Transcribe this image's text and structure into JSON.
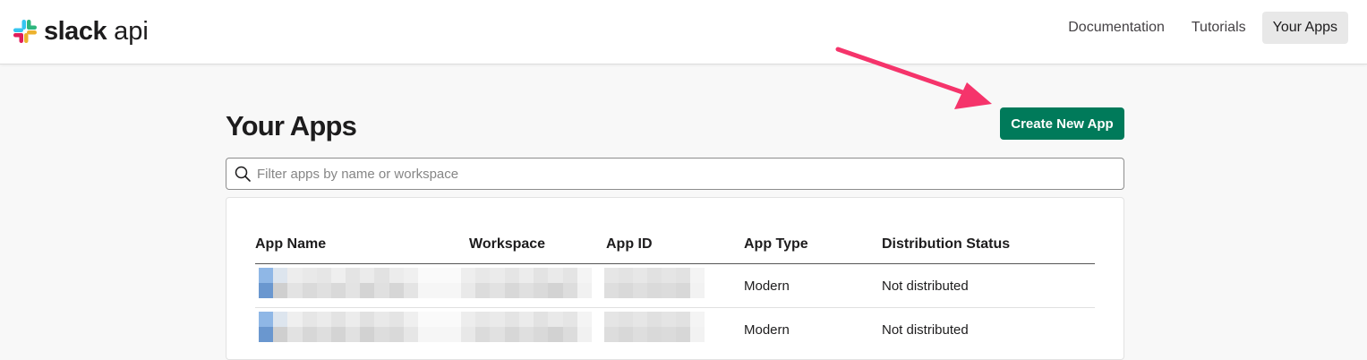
{
  "header": {
    "logo": {
      "word": "slack",
      "sub": "api"
    },
    "nav": [
      {
        "label": "Documentation",
        "active": false
      },
      {
        "label": "Tutorials",
        "active": false
      },
      {
        "label": "Your Apps",
        "active": true
      }
    ]
  },
  "main": {
    "title": "Your Apps",
    "create_button": "Create New App",
    "search": {
      "placeholder": "Filter apps by name or workspace",
      "value": ""
    },
    "table": {
      "columns": [
        "App Name",
        "Workspace",
        "App ID",
        "App Type",
        "Distribution Status"
      ],
      "rows": [
        {
          "app_name": "[pixelated]",
          "workspace": "[pixelated]",
          "app_id": "[pixelated]",
          "app_type": "Modern",
          "distribution_status": "Not distributed"
        },
        {
          "app_name": "[pixelated]",
          "workspace": "[pixelated]",
          "app_id": "[pixelated]",
          "app_type": "Modern",
          "distribution_status": "Not distributed"
        }
      ]
    }
  },
  "colors": {
    "primary_button": "#007a5a",
    "annotation_arrow": "#f5346b",
    "active_nav_bg": "#e8e8e8"
  },
  "icons": [
    "slack-logo-icon",
    "search-icon",
    "annotation-arrow"
  ]
}
